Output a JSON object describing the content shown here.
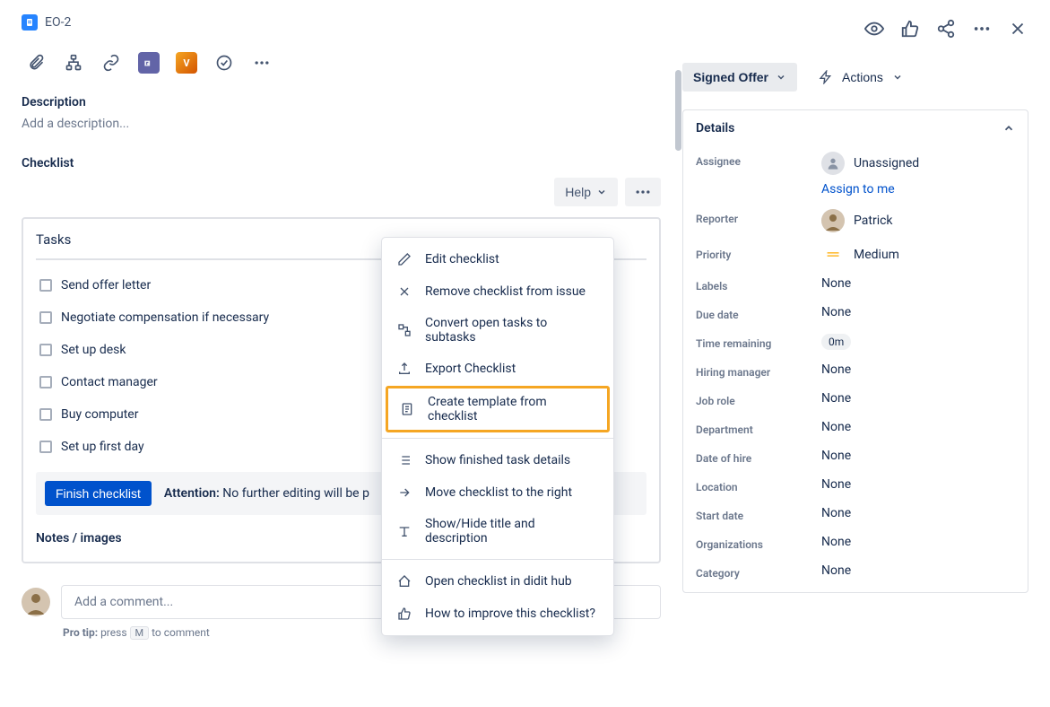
{
  "issue": {
    "key": "EO-2"
  },
  "top_actions": {},
  "sections": {
    "description_title": "Description",
    "description_placeholder": "Add a description...",
    "checklist_title": "Checklist",
    "help_label": "Help",
    "tasks_title": "Tasks",
    "notes_title": "Notes / images"
  },
  "tasks": [
    "Send offer letter",
    "Negotiate compensation if necessary",
    "Set up desk",
    "Contact manager",
    "Buy computer",
    "Set up first day"
  ],
  "finish": {
    "button": "Finish checklist",
    "attention_label": "Attention:",
    "attention_text": "No further editing will be p"
  },
  "dropdown": {
    "edit": "Edit checklist",
    "remove": "Remove checklist from issue",
    "convert": "Convert open tasks to subtasks",
    "export": "Export Checklist",
    "create_template": "Create template from checklist",
    "show_finished": "Show finished task details",
    "move_right": "Move checklist to the right",
    "show_hide": "Show/Hide title and description",
    "open_hub": "Open checklist in didit hub",
    "improve": "How to improve this checklist?"
  },
  "comment": {
    "placeholder": "Add a comment...",
    "pro_tip_label": "Pro tip:",
    "pro_tip_press": "press",
    "pro_tip_key": "M",
    "pro_tip_after": "to comment"
  },
  "status": {
    "label": "Signed Offer",
    "actions_label": "Actions"
  },
  "details": {
    "header": "Details",
    "fields": {
      "assignee_label": "Assignee",
      "assignee_value": "Unassigned",
      "assign_link": "Assign to me",
      "reporter_label": "Reporter",
      "reporter_value": "Patrick",
      "priority_label": "Priority",
      "priority_value": "Medium",
      "labels_label": "Labels",
      "labels_value": "None",
      "due_label": "Due date",
      "due_value": "None",
      "time_label": "Time remaining",
      "time_value": "0m",
      "hiring_label": "Hiring manager",
      "hiring_value": "None",
      "job_label": "Job role",
      "job_value": "None",
      "dept_label": "Department",
      "dept_value": "None",
      "hire_date_label": "Date of hire",
      "hire_date_value": "None",
      "location_label": "Location",
      "location_value": "None",
      "start_label": "Start date",
      "start_value": "None",
      "org_label": "Organizations",
      "org_value": "None",
      "cat_label": "Category",
      "cat_value": "None"
    }
  }
}
